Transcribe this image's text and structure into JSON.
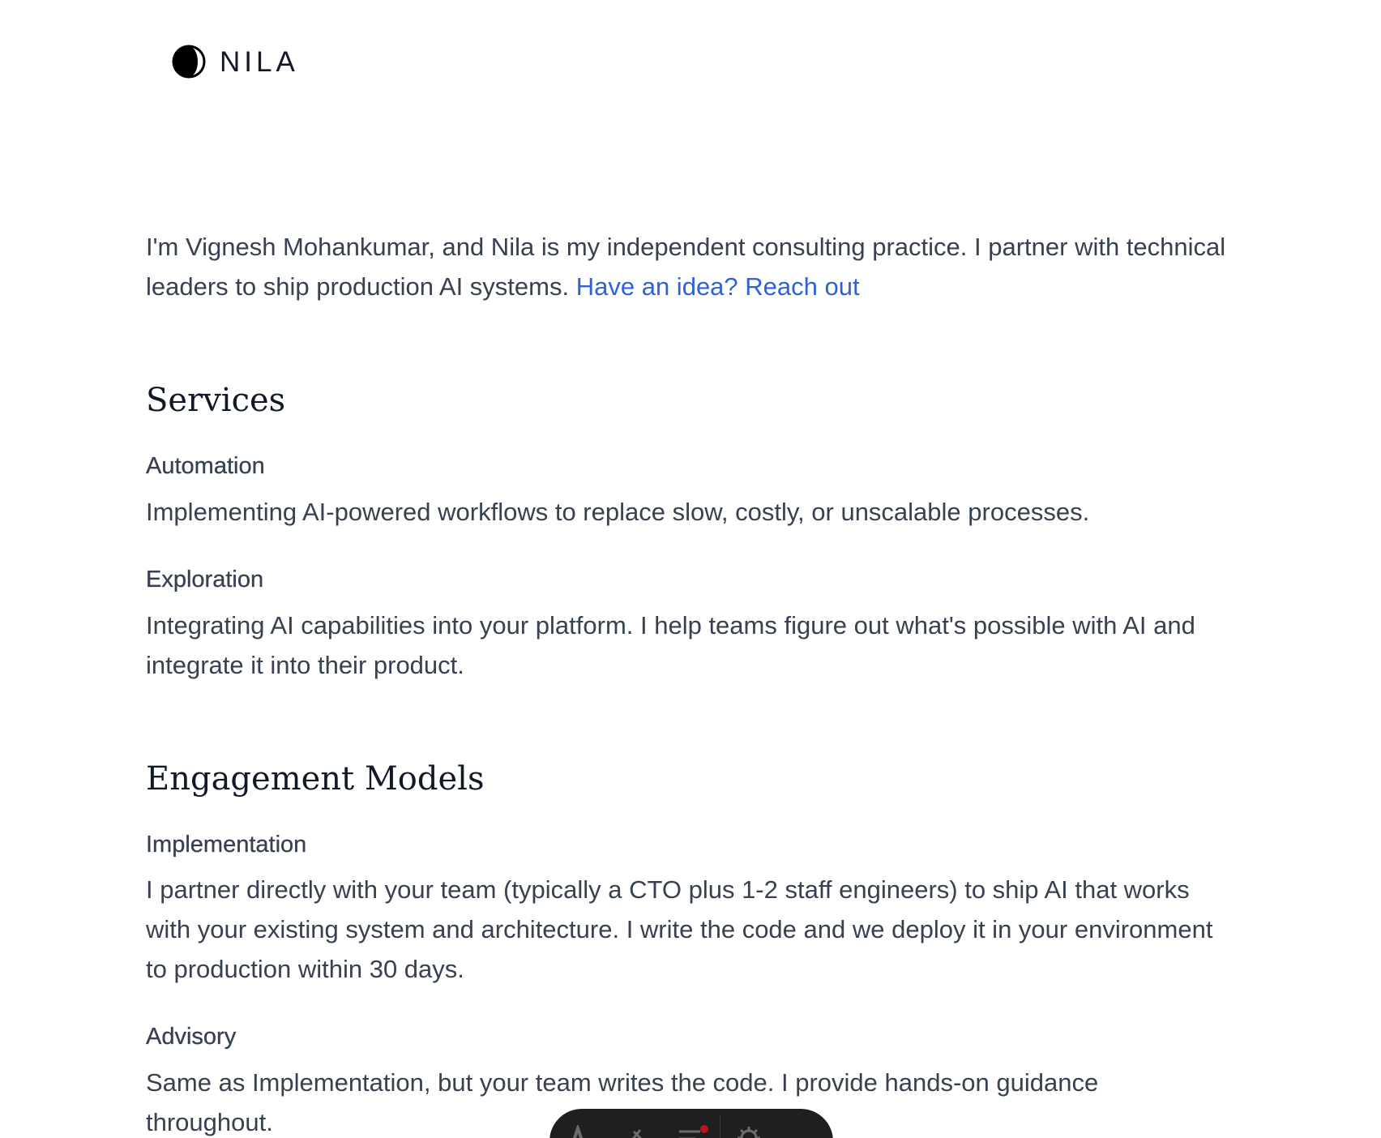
{
  "brand": {
    "name": "NILA"
  },
  "intro": {
    "text": "I'm Vignesh Mohankumar, and Nila is my independent consulting practice. I partner with technical leaders to ship production AI systems.",
    "link_label": "Have an idea? Reach out"
  },
  "services": {
    "heading": "Services",
    "items": [
      {
        "title": "Automation",
        "description": "Implementing AI-powered workflows to replace slow, costly, or unscalable processes."
      },
      {
        "title": "Exploration",
        "description": "Integrating AI capabilities into your platform. I help teams figure out what's possible with AI and integrate it into their product."
      }
    ]
  },
  "engagement": {
    "heading": "Engagement Models",
    "items": [
      {
        "title": "Implementation",
        "description": "I partner directly with your team (typically a CTO plus 1-2 staff engineers) to ship AI that works with your existing system and architecture. I write the code and we deploy it in your environment to production within 30 days."
      },
      {
        "title": "Advisory",
        "description": "Same as Implementation, but your team writes the code. I provide hands-on guidance throughout."
      }
    ]
  },
  "toolbar": {
    "icons": [
      "text-icon",
      "highlight-icon",
      "list-icon",
      "settings-icon"
    ],
    "notification_color": "#c1121f"
  },
  "colors": {
    "link": "#2f62d6",
    "text": "#374151",
    "heading": "#111827"
  }
}
